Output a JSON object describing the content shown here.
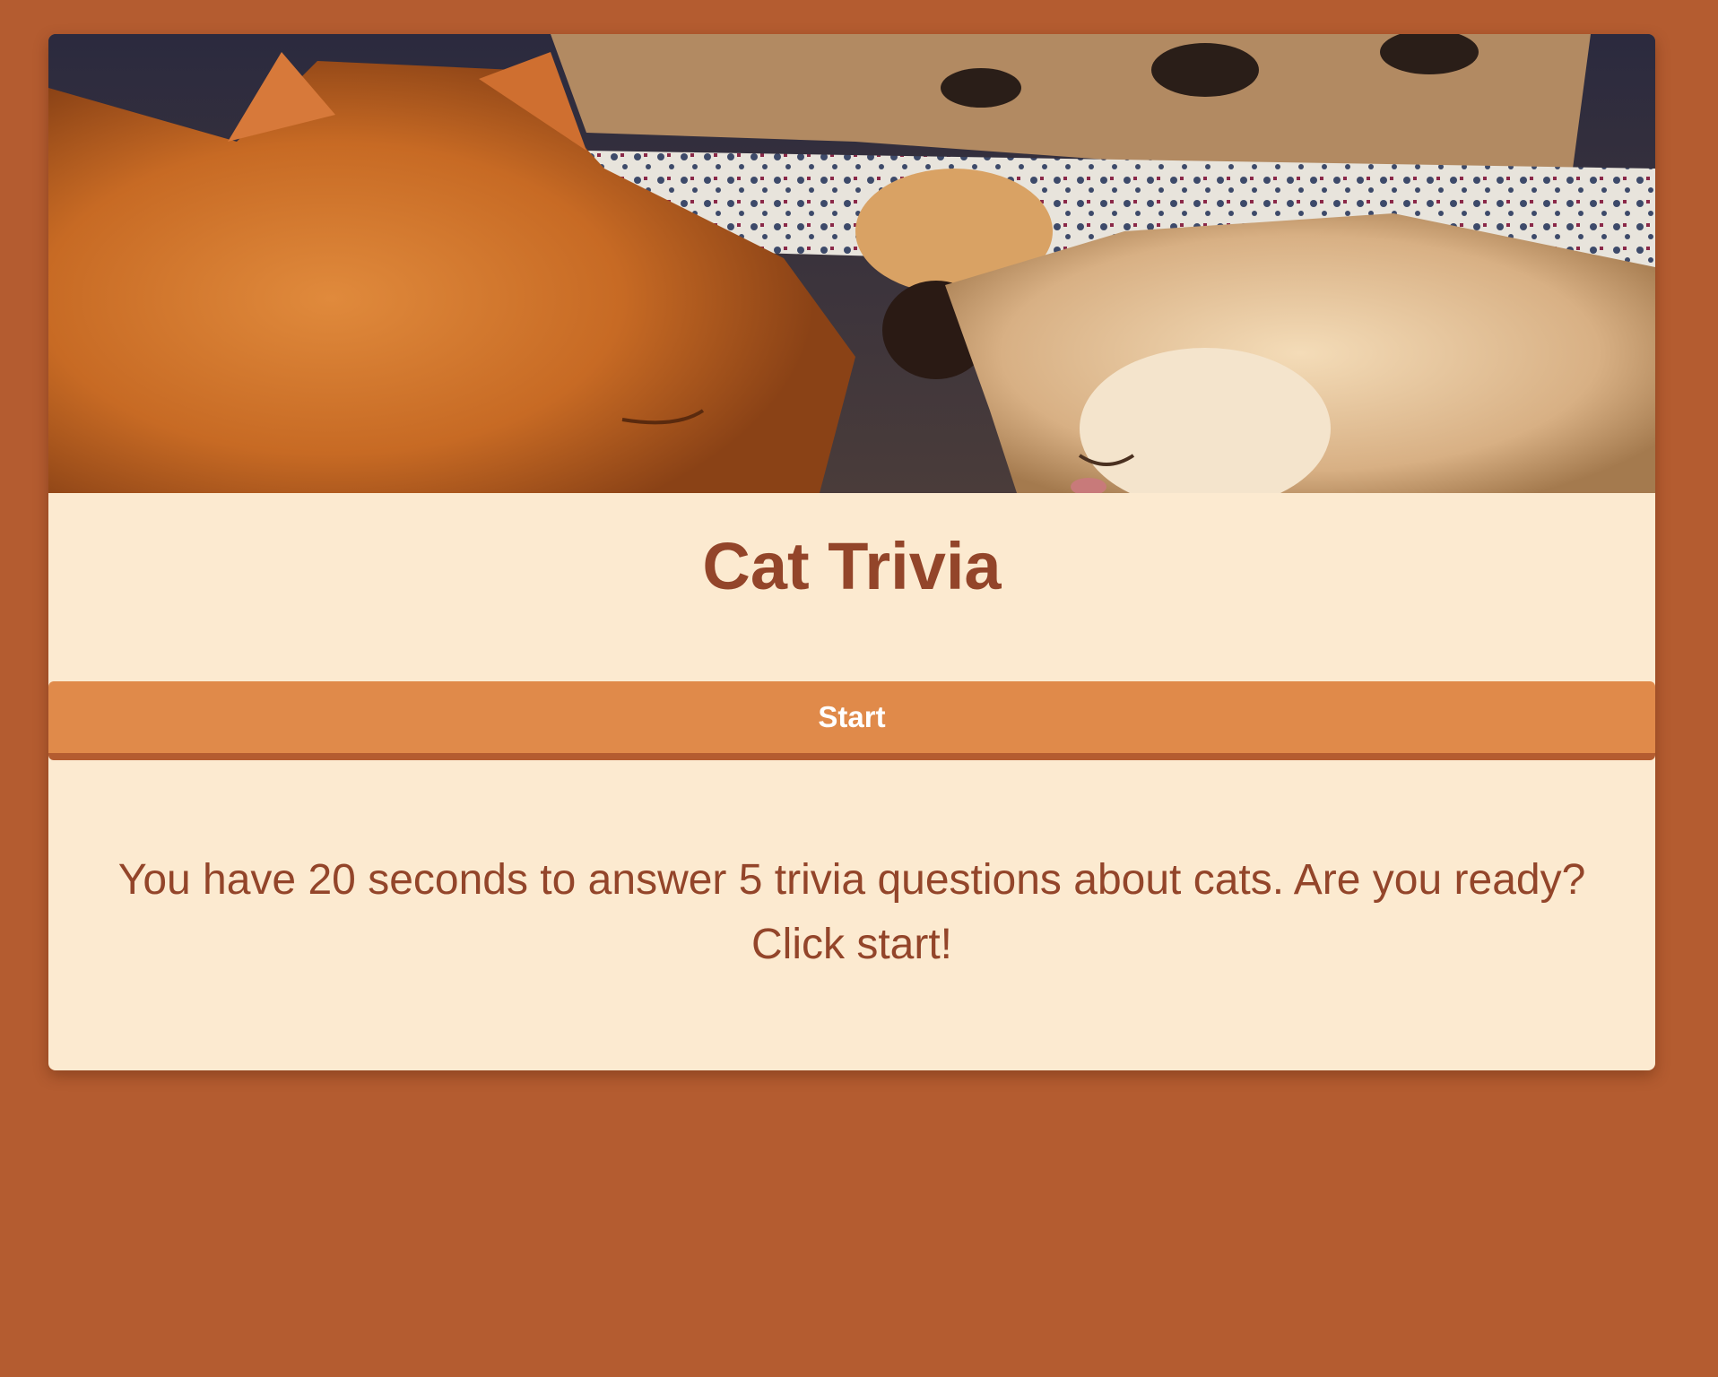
{
  "theme": {
    "background": "#b45c30",
    "card_background": "#fcead0",
    "accent": "#e08a4a",
    "text": "#93452a",
    "button_text": "#ffffff"
  },
  "hero": {
    "image": "two-cats-sleeping-photo"
  },
  "page": {
    "title": "Cat Trivia",
    "start_label": "Start",
    "intro_text": "You have 20 seconds to answer 5 trivia questions about cats. Are you ready? Click start!"
  }
}
